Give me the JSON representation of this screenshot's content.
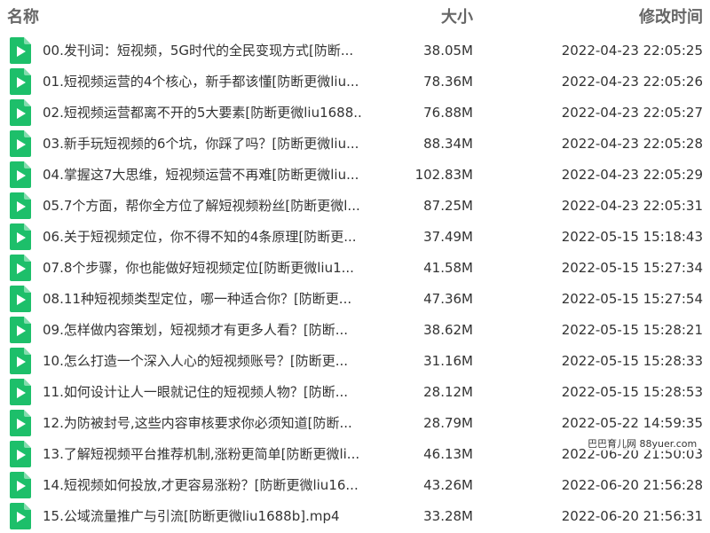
{
  "header": {
    "name": "名称",
    "size": "大小",
    "modified": "修改时间"
  },
  "colors": {
    "icon_green": "#1dbf6a",
    "text": "#333333",
    "header_text": "#666666"
  },
  "icon": "video-play-file-icon",
  "files": [
    {
      "name": "00.发刊词：短视频，5G时代的全民变现方式[防断...",
      "size": "38.05M",
      "modified": "2022-04-23 22:05:25"
    },
    {
      "name": "01.短视频运营的4个核心，新手都该懂[防断更微liu...",
      "size": "78.36M",
      "modified": "2022-04-23 22:05:26"
    },
    {
      "name": "02.短视频运营都离不开的5大要素[防断更微liu1688...",
      "size": "76.88M",
      "modified": "2022-04-23 22:05:27"
    },
    {
      "name": "03.新手玩短视频的6个坑，你踩了吗？[防断更微liu...",
      "size": "88.34M",
      "modified": "2022-04-23 22:05:28"
    },
    {
      "name": "04.掌握这7大思维，短视频运营不再难[防断更微liu...",
      "size": "102.83M",
      "modified": "2022-04-23 22:05:29"
    },
    {
      "name": "05.7个方面，帮你全方位了解短视频粉丝[防断更微l...",
      "size": "87.25M",
      "modified": "2022-04-23 22:05:31"
    },
    {
      "name": "06.关于短视频定位，你不得不知的4条原理[防断更...",
      "size": "37.49M",
      "modified": "2022-05-15 15:18:43"
    },
    {
      "name": "07.8个步骤，你也能做好短视频定位[防断更微liu1...",
      "size": "41.58M",
      "modified": "2022-05-15 15:27:34"
    },
    {
      "name": "08.11种短视频类型定位，哪一种适合你？[防断更...",
      "size": "47.36M",
      "modified": "2022-05-15 15:27:54"
    },
    {
      "name": "09.怎样做内容策划，短视频才有更多人看？[防断...",
      "size": "38.62M",
      "modified": "2022-05-15 15:28:21"
    },
    {
      "name": "10.怎么打造一个深入人心的短视频账号？[防断更...",
      "size": "31.16M",
      "modified": "2022-05-15 15:28:33"
    },
    {
      "name": "11.如何设计让人一眼就记住的短视频人物？[防断...",
      "size": "28.12M",
      "modified": "2022-05-15 15:28:53"
    },
    {
      "name": "12.为防被封号,这些内容审核要求你必须知道[防断...",
      "size": "28.79M",
      "modified": "2022-05-22 14:59:35"
    },
    {
      "name": "13.了解短视频平台推荐机制,涨粉更简单[防断更微li...",
      "size": "46.13M",
      "modified": "2022-06-20 21:50:03"
    },
    {
      "name": "14.短视频如何投放,才更容易涨粉？[防断更微liu16...",
      "size": "43.26M",
      "modified": "2022-06-20 21:56:28"
    },
    {
      "name": "15.公域流量推广与引流[防断更微liu1688b].mp4",
      "size": "33.28M",
      "modified": "2022-06-20 21:56:31"
    }
  ],
  "watermark": "巴巴育儿网 88yuer.com"
}
